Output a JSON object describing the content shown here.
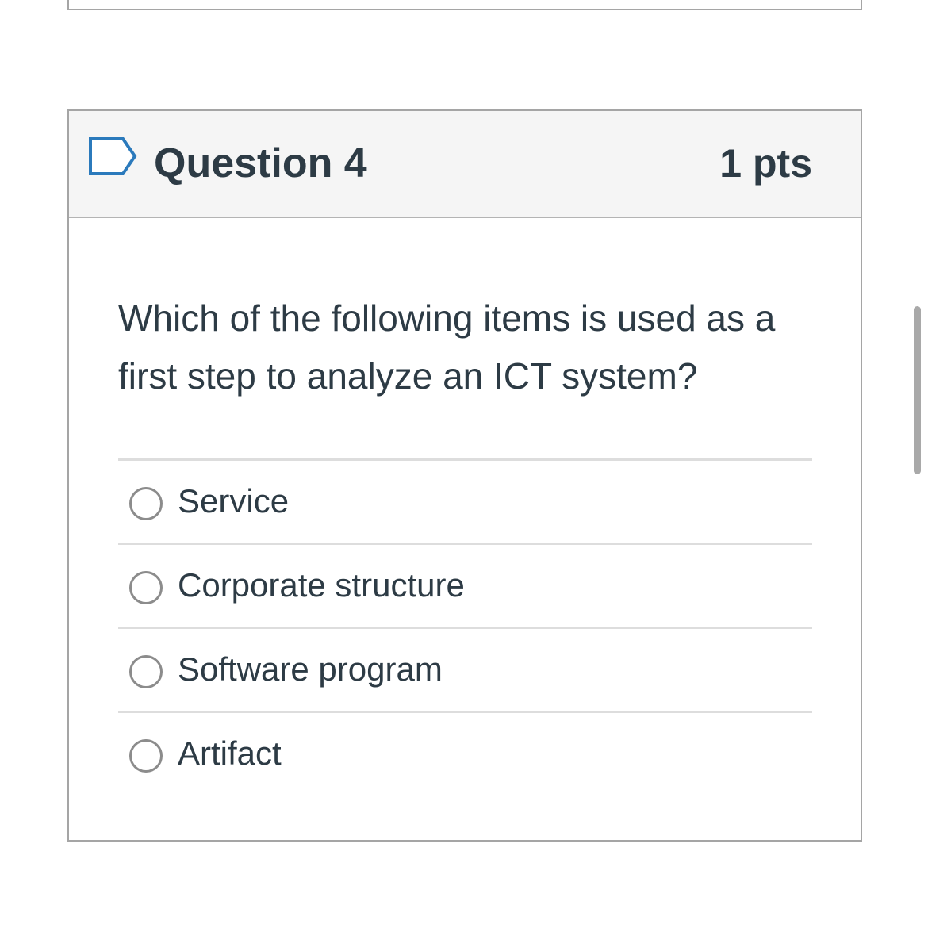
{
  "question": {
    "title": "Question 4",
    "points": "1 pts",
    "text": "Which of the following items is used as a first step to analyze an ICT system?",
    "flag_icon": "flag-bookmark-icon"
  },
  "answers": [
    {
      "label": "Service",
      "selected": false
    },
    {
      "label": "Corporate structure",
      "selected": false
    },
    {
      "label": "Software program",
      "selected": false
    },
    {
      "label": "Artifact",
      "selected": false
    }
  ],
  "colors": {
    "text": "#2d3b45",
    "header_bg": "#f5f5f5",
    "border": "#a5a5a5",
    "flag": "#2b7abc",
    "radio_border": "#8c8c8c"
  }
}
